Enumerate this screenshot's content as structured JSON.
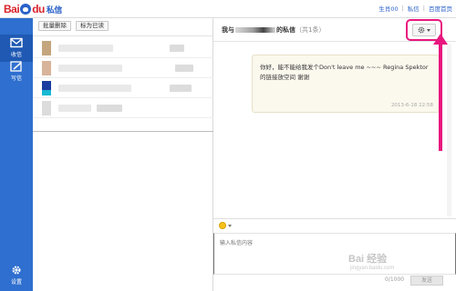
{
  "brand": {
    "logo_bai": "Bai",
    "logo_du": "du",
    "product": "私信"
  },
  "toplinks": {
    "user": "生肖00",
    "messages": "私信",
    "home": "百度首页"
  },
  "sidebar": {
    "items": [
      {
        "label": "收信",
        "icon": "mail-icon"
      },
      {
        "label": "写信",
        "icon": "edit-icon"
      },
      {
        "label": "设置",
        "icon": "gear-icon"
      }
    ]
  },
  "list": {
    "batch_delete": "批量删除",
    "mark_read": "标为已读",
    "rows": [
      {
        "avatar_color": "#c4a57d"
      },
      {
        "avatar_color": "#d8b49a"
      },
      {
        "avatar_color": "#1b3da0"
      },
      {
        "avatar_color": "#d9d9d9"
      }
    ]
  },
  "chat": {
    "title_prefix": "我与",
    "title_suffix": "的私信",
    "count": "（共1条）",
    "message": "你好，能不能给我发个Don't leave me ~~~ Regina Spektor 的链接放空间 谢谢",
    "time": "2013-6-18 22:58",
    "placeholder": "输入私信内容",
    "char_count": "0/1000",
    "send": "发送"
  },
  "watermark": {
    "main": "Bai 经验",
    "sub": "jingyan.baidu.com"
  },
  "colors": {
    "sidebar": "#2e6fcf",
    "highlight": "#e8177e",
    "brand_red": "#d8232a",
    "link_blue": "#2a61c9"
  }
}
